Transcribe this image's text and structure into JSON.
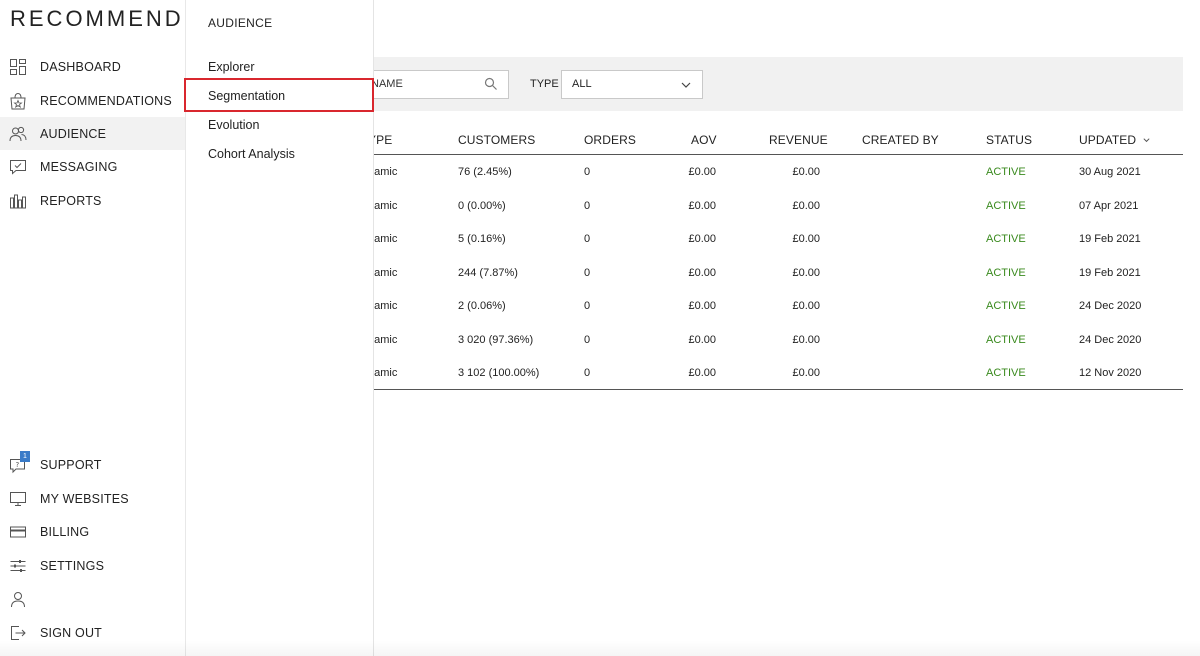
{
  "brand": {
    "logo": "RECOMMEND"
  },
  "sidebar": {
    "items": [
      {
        "label": "DASHBOARD",
        "icon": "dashboard-icon"
      },
      {
        "label": "RECOMMENDATIONS",
        "icon": "shopping-bag-star-icon"
      },
      {
        "label": "AUDIENCE",
        "icon": "people-icon",
        "active": true
      },
      {
        "label": "MESSAGING",
        "icon": "chat-icon"
      },
      {
        "label": "REPORTS",
        "icon": "bar-chart-icon"
      }
    ],
    "bottom_items": [
      {
        "label": "SUPPORT",
        "icon": "support-chat-icon",
        "badge": "1"
      },
      {
        "label": "MY WEBSITES",
        "icon": "monitor-icon"
      },
      {
        "label": "BILLING",
        "icon": "credit-card-icon"
      },
      {
        "label": "SETTINGS",
        "icon": "sliders-icon"
      },
      {
        "label": "",
        "icon": "user-icon"
      },
      {
        "label": "SIGN OUT",
        "icon": "sign-out-icon"
      }
    ]
  },
  "flyout": {
    "title": "AUDIENCE",
    "items": [
      "Explorer",
      "Segmentation",
      "Evolution",
      "Cohort Analysis"
    ],
    "selected": "Segmentation"
  },
  "filters": {
    "name_label": "NAME",
    "type_label": "TYPE",
    "type_value": "ALL"
  },
  "table": {
    "columns": [
      "YPE",
      "CUSTOMERS",
      "ORDERS",
      "AOV",
      "REVENUE",
      "CREATED BY",
      "STATUS",
      "UPDATED"
    ],
    "rows": [
      [
        "namic",
        "76 (2.45%)",
        "0",
        "£0.00",
        "£0.00",
        "",
        "ACTIVE",
        "30 Aug 2021"
      ],
      [
        "namic",
        "0 (0.00%)",
        "0",
        "£0.00",
        "£0.00",
        "",
        "ACTIVE",
        "07 Apr 2021"
      ],
      [
        "namic",
        "5 (0.16%)",
        "0",
        "£0.00",
        "£0.00",
        "",
        "ACTIVE",
        "19 Feb 2021"
      ],
      [
        "namic",
        "244 (7.87%)",
        "0",
        "£0.00",
        "£0.00",
        "",
        "ACTIVE",
        "19 Feb 2021"
      ],
      [
        "namic",
        "2 (0.06%)",
        "0",
        "£0.00",
        "£0.00",
        "",
        "ACTIVE",
        "24 Dec 2020"
      ],
      [
        "namic",
        "3 020 (97.36%)",
        "0",
        "£0.00",
        "£0.00",
        "",
        "ACTIVE",
        "24 Dec 2020"
      ],
      [
        "namic",
        "3 102 (100.00%)",
        "0",
        "£0.00",
        "£0.00",
        "",
        "ACTIVE",
        "12 Nov 2020"
      ]
    ]
  },
  "colors": {
    "status_active": "#3a8a1e",
    "highlight": "#d9272e",
    "badge": "#3a7bc8"
  }
}
